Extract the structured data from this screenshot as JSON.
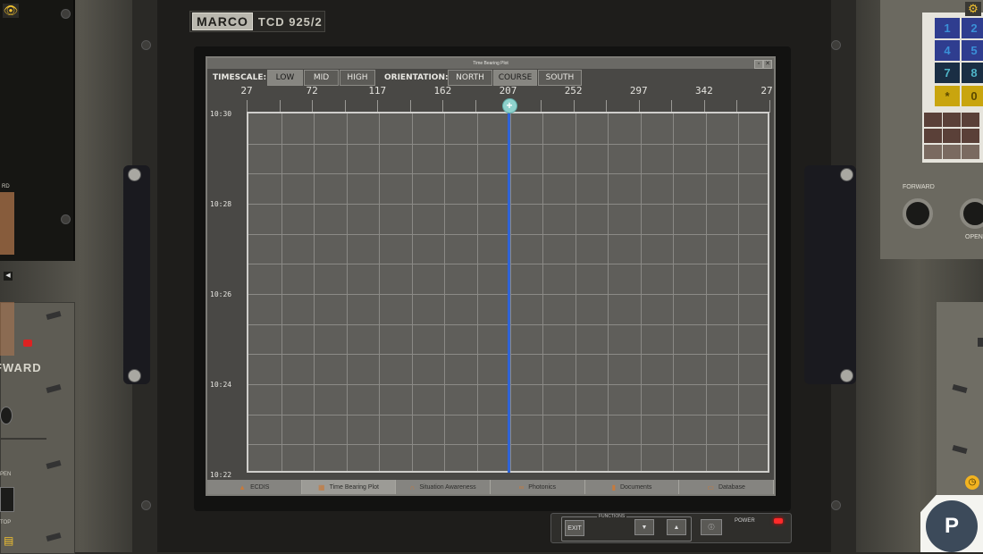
{
  "brand": {
    "logo": "MARCO",
    "model": "TCD 925/2"
  },
  "window": {
    "title": "Time Bearing Plot",
    "btn_restore": "▫",
    "btn_close": "✕"
  },
  "controls": {
    "timescale_label": "TIMESCALE:",
    "timescale": [
      {
        "label": "LOW",
        "active": true
      },
      {
        "label": "MID",
        "active": false
      },
      {
        "label": "HIGH",
        "active": false
      }
    ],
    "orientation_label": "ORIENTATION:",
    "orientation": [
      {
        "label": "NORTH",
        "active": false
      },
      {
        "label": "COURSE",
        "active": true
      },
      {
        "label": "SOUTH",
        "active": false
      }
    ]
  },
  "plot": {
    "bearing_labels": [
      "27",
      "72",
      "117",
      "162",
      "207",
      "252",
      "297",
      "342",
      "27"
    ],
    "time_labels": [
      "10:30",
      "10:28",
      "10:26",
      "10:24",
      "10:22"
    ],
    "cursor_bearing": 207,
    "cursor_symbol": "+",
    "cursor_color": "#2f64d8"
  },
  "tabs": [
    {
      "label": "ECDIS",
      "icon": "ecdis-icon",
      "glyph": "▲"
    },
    {
      "label": "Time Bearing Plot",
      "icon": "plot-icon",
      "glyph": "▦"
    },
    {
      "label": "Situation Awareness",
      "icon": "headphones-icon",
      "glyph": "∩"
    },
    {
      "label": "Photonics",
      "icon": "binoculars-icon",
      "glyph": "∞"
    },
    {
      "label": "Documents",
      "icon": "documents-icon",
      "glyph": "▮"
    },
    {
      "label": "Database",
      "icon": "monitor-icon",
      "glyph": "▭"
    }
  ],
  "functions": {
    "label": "FUNCTIONS",
    "exit": "EXIT",
    "down": "▼",
    "up": "▲",
    "info": "ⓘ",
    "power_label": "POWER"
  },
  "keypad": [
    "1",
    "2",
    "4",
    "5",
    "7",
    "8",
    "*",
    "0"
  ],
  "right_panel": {
    "forward_label": "FORWARD",
    "open_label": "OPEN"
  },
  "left_panel": {
    "fward_label": "FWARD",
    "pen_label": "PEN",
    "top_label": "TOP",
    "small_label": "RD"
  },
  "badge": {
    "letter": "P"
  },
  "colors": {
    "accent": "#f2c230",
    "power_led": "#ff2a2a"
  }
}
